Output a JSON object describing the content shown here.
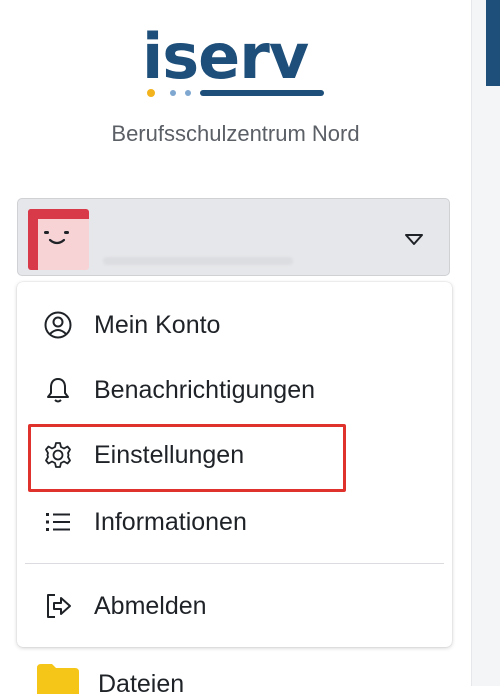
{
  "brand": {
    "logo_text": "iserv",
    "school_name": "Berufsschulzentrum Nord"
  },
  "colors": {
    "brand_blue": "#1e4f7a",
    "dot_yellow": "#f2b31c",
    "dot_lightblue": "#7fa7d0",
    "highlight_red": "#e0322d",
    "folder_yellow": "#f5c518"
  },
  "user": {
    "avatar_icon": "smiley-avatar-icon",
    "dropdown_icon": "triangle-down-icon"
  },
  "menu": {
    "items": [
      {
        "label": "Mein Konto",
        "icon": "user-circle-icon"
      },
      {
        "label": "Benachrichtigungen",
        "icon": "bell-icon"
      },
      {
        "label": "Einstellungen",
        "icon": "gear-icon"
      },
      {
        "label": "Informationen",
        "icon": "list-icon"
      },
      {
        "label": "Abmelden",
        "icon": "logout-icon"
      }
    ]
  },
  "nav": {
    "files_label": "Dateien",
    "files_icon": "folder-icon"
  }
}
